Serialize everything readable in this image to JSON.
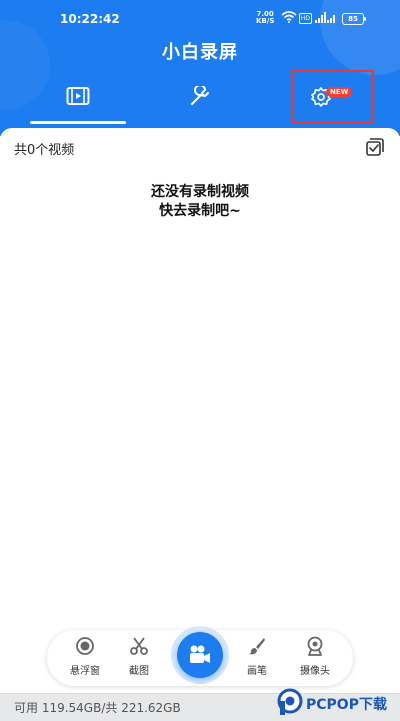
{
  "status_bar": {
    "time": "10:22:42",
    "net_speed": "7.00",
    "net_unit": "KB/S",
    "network_badge": "HD",
    "battery": "85"
  },
  "app": {
    "title": "小白录屏"
  },
  "tabs": [
    {
      "name": "videos",
      "icon": "film-icon",
      "active": true
    },
    {
      "name": "tools",
      "icon": "wrench-icon",
      "active": false
    },
    {
      "name": "settings",
      "icon": "gear-icon",
      "active": false,
      "badge": "NEW"
    }
  ],
  "content": {
    "video_count": "共0个视频",
    "empty_line1": "还没有录制视频",
    "empty_line2": "快去录制吧~"
  },
  "toolbar": {
    "items": [
      {
        "label": "悬浮窗",
        "icon": "target-circle-icon"
      },
      {
        "label": "截图",
        "icon": "scissors-icon"
      },
      {
        "label": "",
        "icon": "video-camera-icon"
      },
      {
        "label": "画笔",
        "icon": "brush-icon"
      },
      {
        "label": "摄像头",
        "icon": "webcam-icon"
      }
    ]
  },
  "storage": {
    "text": "可用 119.54GB/共 221.62GB"
  },
  "watermark": {
    "text": "PCPOP下载"
  },
  "colors": {
    "primary": "#1c7cf0",
    "highlight": "#e53935",
    "badge": "#ff3b30",
    "watermark": "#1b57b7"
  }
}
